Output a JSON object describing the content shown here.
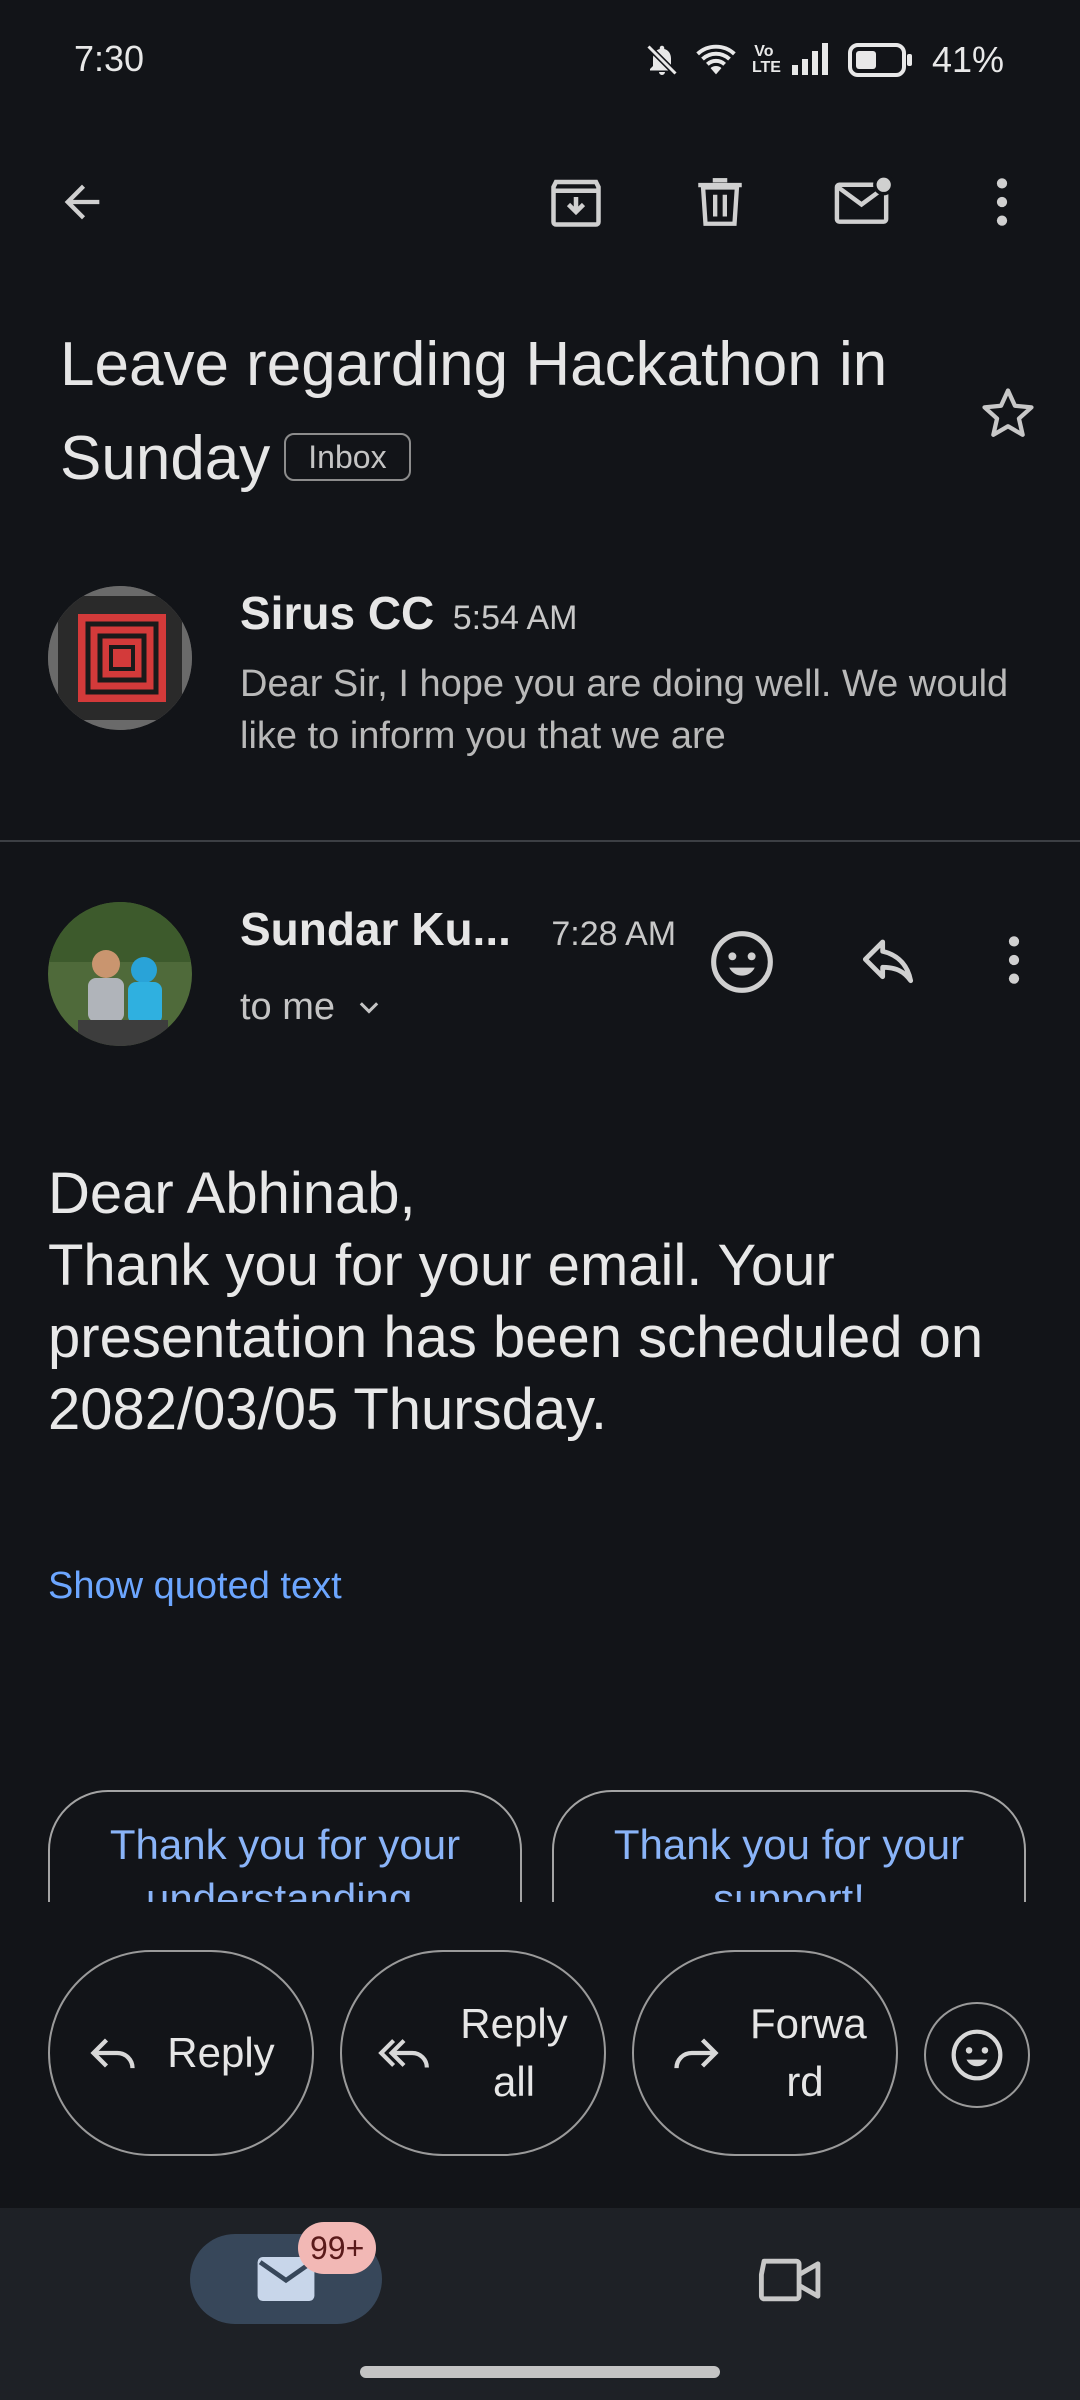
{
  "status_bar": {
    "time": "7:30",
    "battery": "41%",
    "network": "Vo LTE"
  },
  "toolbar": {
    "back_icon": "arrow-left-icon",
    "archive_icon": "archive-icon",
    "delete_icon": "trash-icon",
    "mark_unread_icon": "mail-unread-icon",
    "more_icon": "more-vert-icon"
  },
  "subject": {
    "text": "Leave regarding Hackathon in Sunday",
    "label": "Inbox",
    "star_icon": "star-outline-icon"
  },
  "messages": [
    {
      "sender": "Sirus CC",
      "time": "5:54 AM",
      "snippet": "Dear Sir, I hope you are doing well. We would like to inform you that we are"
    },
    {
      "sender": "Sundar Ku...",
      "time": "7:28 AM",
      "recipient": "to me",
      "body": [
        "Dear Abhinab,",
        "Thank you for your email. Your presentation has been scheduled on 2082/03/05 Thursday."
      ],
      "show_quoted": "Show quoted text"
    }
  ],
  "smart_replies": [
    "Thank you for your understanding.",
    "Thank you for your support!"
  ],
  "actions": {
    "reply": "Reply",
    "reply_all": "Reply all",
    "forward": "Forwa rd"
  },
  "bottom_nav": {
    "mail_badge": "99+"
  },
  "colors": {
    "background": "#121418",
    "accent": "#8ab4f8",
    "link": "#6ca6ff",
    "badge": "#f2b8b5"
  }
}
